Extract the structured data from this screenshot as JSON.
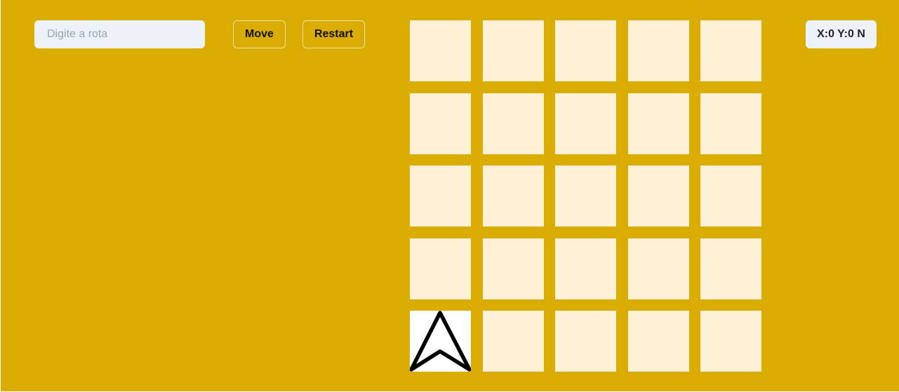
{
  "controls": {
    "route_placeholder": "Digite a rota",
    "route_value": "",
    "move_label": "Move",
    "restart_label": "Restart"
  },
  "status": {
    "position_text": "X:0 Y:0 N"
  },
  "board": {
    "columns": 5,
    "rows": 5,
    "robot": {
      "x": 0,
      "y": 0,
      "heading": "N",
      "icon": "navigation-arrow-icon"
    },
    "colors": {
      "background": "#dbac00",
      "cell": "#fff1d6",
      "robot_cell": "#ffffff",
      "arrow": "#000000"
    }
  }
}
